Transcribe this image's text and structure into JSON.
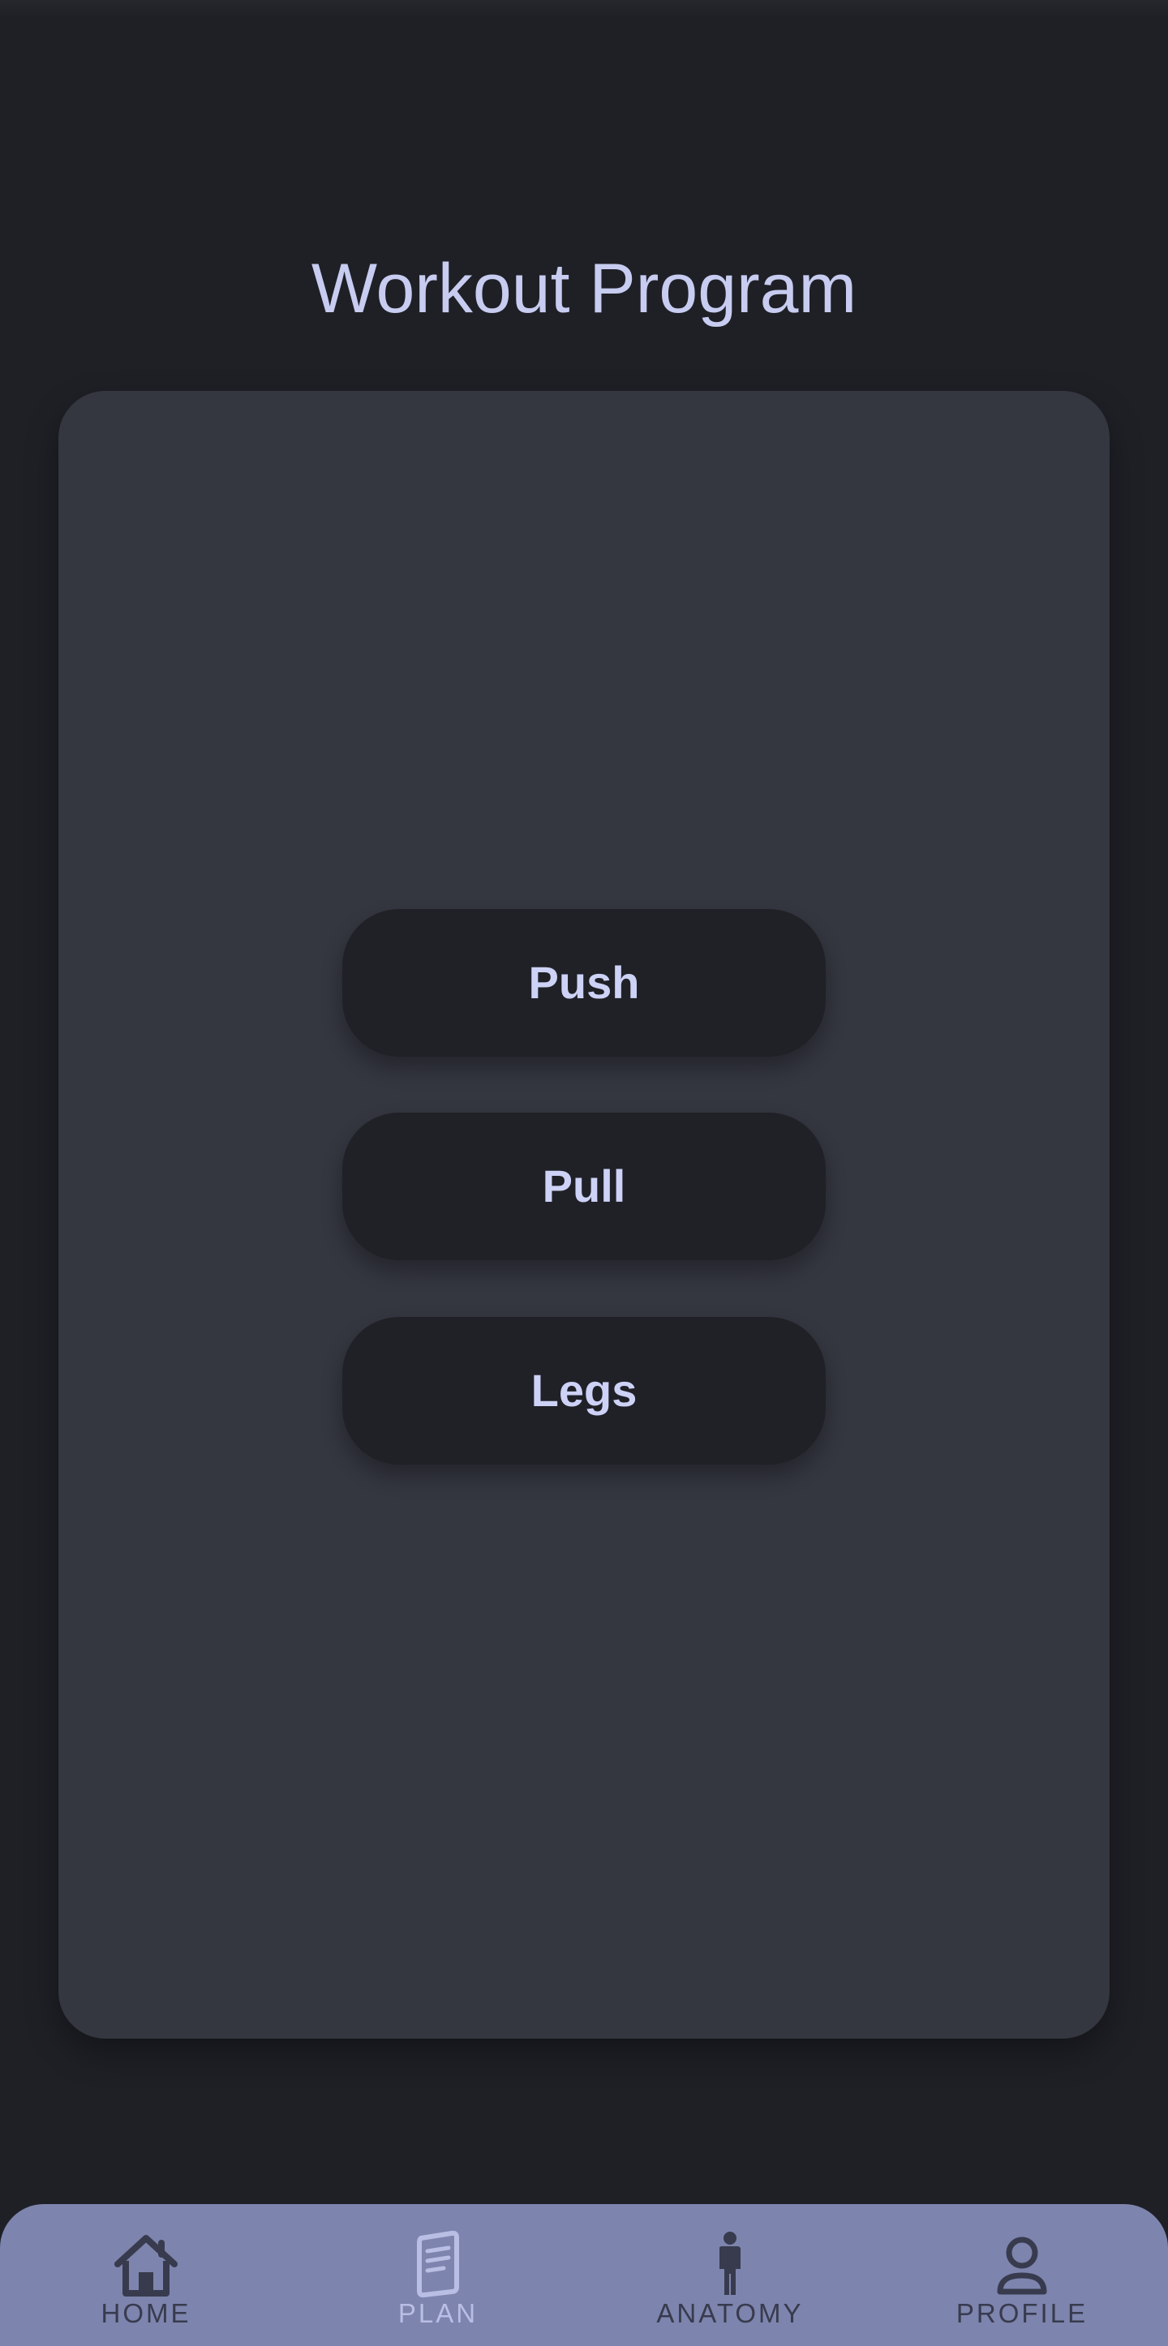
{
  "header": {
    "title": "Workout Program"
  },
  "program": {
    "buttons": [
      {
        "label": "Push"
      },
      {
        "label": "Pull"
      },
      {
        "label": "Legs"
      }
    ]
  },
  "bottom_nav": {
    "active": "PLAN",
    "items": [
      {
        "label": "HOME",
        "icon": "home-icon"
      },
      {
        "label": "PLAN",
        "icon": "document-icon"
      },
      {
        "label": "ANATOMY",
        "icon": "body-icon"
      },
      {
        "label": "PROFILE",
        "icon": "person-icon"
      }
    ]
  },
  "colors": {
    "background": "#1f2026",
    "card": "#343640",
    "button": "#202127",
    "accent_text": "#c7ccf0",
    "nav_background": "#7d84ad",
    "nav_inactive": "#383b4e",
    "nav_active": "#b9bee4"
  }
}
